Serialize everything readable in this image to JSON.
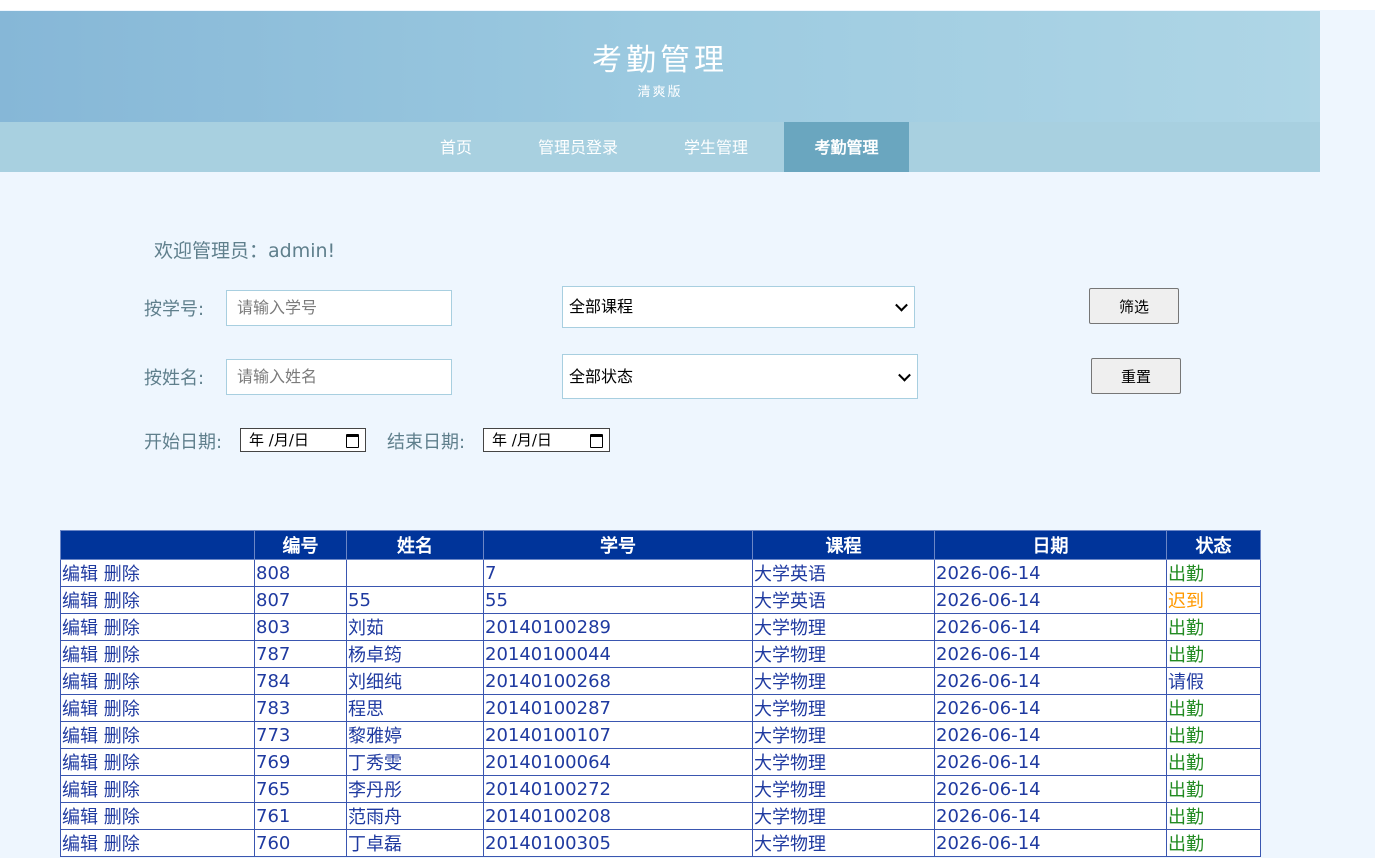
{
  "header": {
    "title": "考勤管理",
    "subtitle": "清爽版"
  },
  "nav": [
    {
      "label": "首页",
      "active": false
    },
    {
      "label": "管理员登录",
      "active": false
    },
    {
      "label": "学生管理",
      "active": false
    },
    {
      "label": "考勤管理",
      "active": true
    }
  ],
  "welcome": "欢迎管理员：admin!",
  "filters": {
    "by_id_label": "按学号:",
    "by_id_placeholder": "请输入学号",
    "by_name_label": "按姓名:",
    "by_name_placeholder": "请输入姓名",
    "course_selected": "全部课程",
    "status_selected": "全部状态",
    "filter_button": "筛选",
    "reset_button": "重置",
    "start_date_label": "开始日期:",
    "end_date_label": "结束日期:",
    "date_placeholder": "年 /月/日"
  },
  "table": {
    "headers": [
      "",
      "编号",
      "姓名",
      "学号",
      "课程",
      "日期",
      "状态"
    ],
    "edit_label": "编辑",
    "delete_label": "删除",
    "rows": [
      {
        "id": "808",
        "name": "",
        "student_no": "7",
        "course": "大学英语",
        "date": "2026-06-14",
        "status": "出勤",
        "status_type": "ok"
      },
      {
        "id": "807",
        "name": "55",
        "student_no": "55",
        "course": "大学英语",
        "date": "2026-06-14",
        "status": "迟到",
        "status_type": "late"
      },
      {
        "id": "803",
        "name": "刘茹",
        "student_no": "20140100289",
        "course": "大学物理",
        "date": "2026-06-14",
        "status": "出勤",
        "status_type": "ok"
      },
      {
        "id": "787",
        "name": "杨卓筠",
        "student_no": "20140100044",
        "course": "大学物理",
        "date": "2026-06-14",
        "status": "出勤",
        "status_type": "ok"
      },
      {
        "id": "784",
        "name": "刘细纯",
        "student_no": "20140100268",
        "course": "大学物理",
        "date": "2026-06-14",
        "status": "请假",
        "status_type": "leave"
      },
      {
        "id": "783",
        "name": "程思",
        "student_no": "20140100287",
        "course": "大学物理",
        "date": "2026-06-14",
        "status": "出勤",
        "status_type": "ok"
      },
      {
        "id": "773",
        "name": "黎雅婷",
        "student_no": "20140100107",
        "course": "大学物理",
        "date": "2026-06-14",
        "status": "出勤",
        "status_type": "ok"
      },
      {
        "id": "769",
        "name": "丁秀雯",
        "student_no": "20140100064",
        "course": "大学物理",
        "date": "2026-06-14",
        "status": "出勤",
        "status_type": "ok"
      },
      {
        "id": "765",
        "name": "李丹彤",
        "student_no": "20140100272",
        "course": "大学物理",
        "date": "2026-06-14",
        "status": "出勤",
        "status_type": "ok"
      },
      {
        "id": "761",
        "name": "范雨舟",
        "student_no": "20140100208",
        "course": "大学物理",
        "date": "2026-06-14",
        "status": "出勤",
        "status_type": "ok"
      },
      {
        "id": "760",
        "name": "丁卓磊",
        "student_no": "20140100305",
        "course": "大学物理",
        "date": "2026-06-14",
        "status": "出勤",
        "status_type": "ok"
      }
    ]
  }
}
